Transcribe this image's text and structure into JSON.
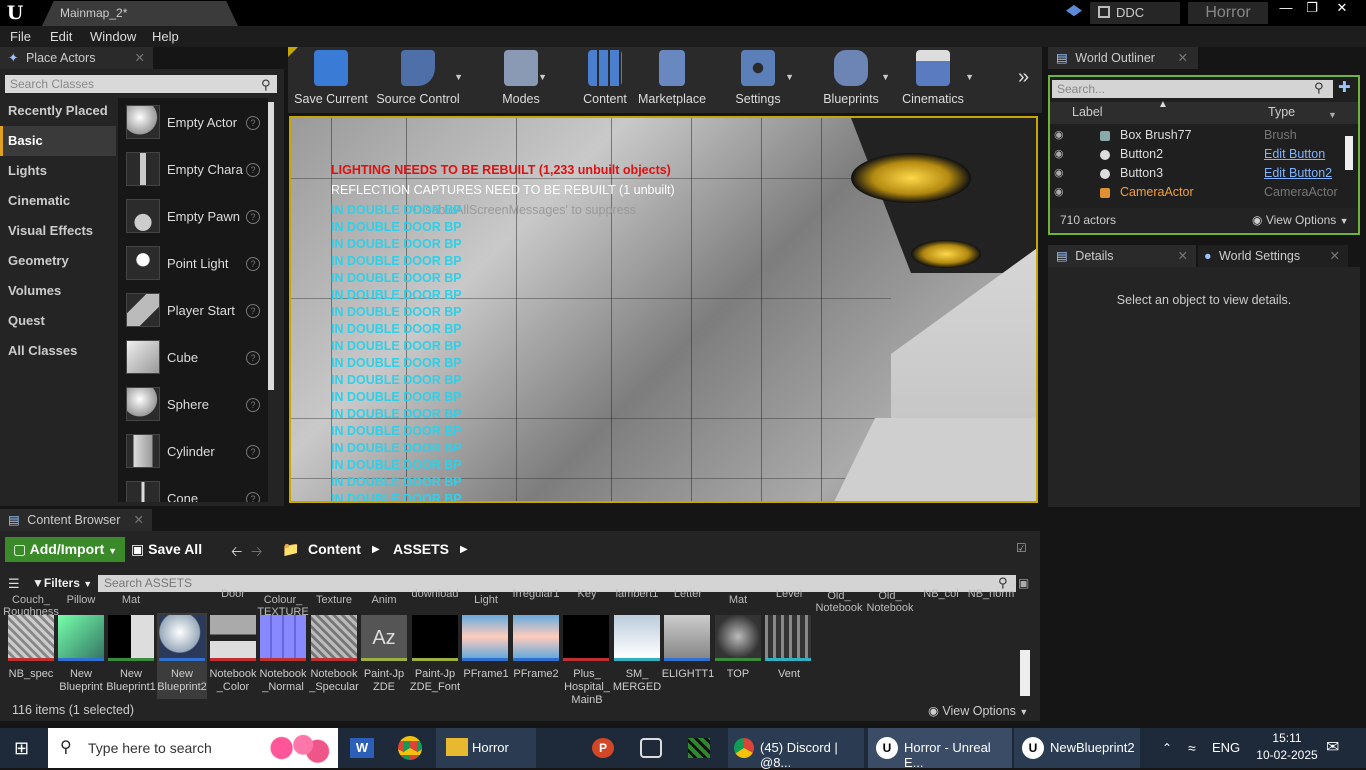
{
  "window": {
    "tab_title": "Mainmap_2*",
    "ddc_label": "DDC",
    "project_name": "Horror"
  },
  "menu": [
    "File",
    "Edit",
    "Window",
    "Help"
  ],
  "place_actors": {
    "tab_label": "Place Actors",
    "search_placeholder": "Search Classes",
    "categories": [
      "Recently Placed",
      "Basic",
      "Lights",
      "Cinematic",
      "Visual Effects",
      "Geometry",
      "Volumes",
      "Quest",
      "All Classes"
    ],
    "selected_category": "Basic",
    "items": [
      "Empty Actor",
      "Empty Chara",
      "Empty Pawn",
      "Point Light",
      "Player Start",
      "Cube",
      "Sphere",
      "Cylinder",
      "Cone"
    ]
  },
  "toolbar": {
    "buttons": [
      "Save Current",
      "Source Control",
      "Modes",
      "Content",
      "Marketplace",
      "Settings",
      "Blueprints",
      "Cinematics"
    ]
  },
  "viewport": {
    "message_lighting": "LIGHTING NEEDS TO BE REBUILT (1,233 unbuilt objects)",
    "message_reflection": "REFLECTION CAPTURES NEED TO BE REBUILT (1 unbuilt)",
    "message_suppress": "'DisableAllScreenMessages' to suppress",
    "debug_line": "IN DOUBLE DOOR BP"
  },
  "world_outliner": {
    "tab_label": "World Outliner",
    "search_placeholder": "Search...",
    "col_label": "Label",
    "col_type": "Type",
    "rows": [
      {
        "label": "Box Brush77",
        "type": "Brush"
      },
      {
        "label": "Button2",
        "type": "Edit Button"
      },
      {
        "label": "Button3",
        "type": "Edit Button2"
      },
      {
        "label": "CameraActor",
        "type": "CameraActor"
      }
    ],
    "actor_count": "710 actors",
    "view_options": "View Options"
  },
  "details": {
    "tab_label": "Details",
    "world_settings_tab": "World Settings",
    "empty_message": "Select an object to view details."
  },
  "content_browser": {
    "tab_label": "Content Browser",
    "add_import": "Add/Import",
    "save_all": "Save All",
    "path": [
      "Content",
      "ASSETS"
    ],
    "filters": "Filters",
    "search_placeholder": "Search ASSETS",
    "top_labels": [
      "Couch_\nRoughness",
      "Pillow",
      "Mat",
      "Door",
      "Colour_\nTEXTURE",
      "Texture",
      "Anim",
      "download",
      "Light",
      "Irregular1",
      "Key",
      "lambert1",
      "Letter",
      "Mat",
      "Level",
      "Old_\nNotebook",
      "Old_\nNotebook",
      "NB_col",
      "NB_norm"
    ],
    "assets": [
      "NB_spec",
      "New\nBlueprint",
      "New\nBlueprint1",
      "New\nBlueprint2",
      "Notebook\n_Color",
      "Notebook\n_Normal",
      "Notebook\n_Specular",
      "Paint-Jp\nZDE",
      "Paint-Jp\nZDE_Font",
      "PFrame1",
      "PFrame2",
      "Plus_\nHospital_\nMainB",
      "SM_\nMERGED",
      "ELIGHTT1",
      "TOP",
      "Vent"
    ],
    "item_count": "116 items (1 selected)",
    "view_options": "View Options"
  },
  "taskbar": {
    "search_placeholder": "Type here to search",
    "apps": [
      "Horror",
      "(45) Discord | @8...",
      "Horror - Unreal E...",
      "NewBlueprint2"
    ],
    "lang": "ENG",
    "time": "15:11",
    "date": "10-02-2025"
  }
}
